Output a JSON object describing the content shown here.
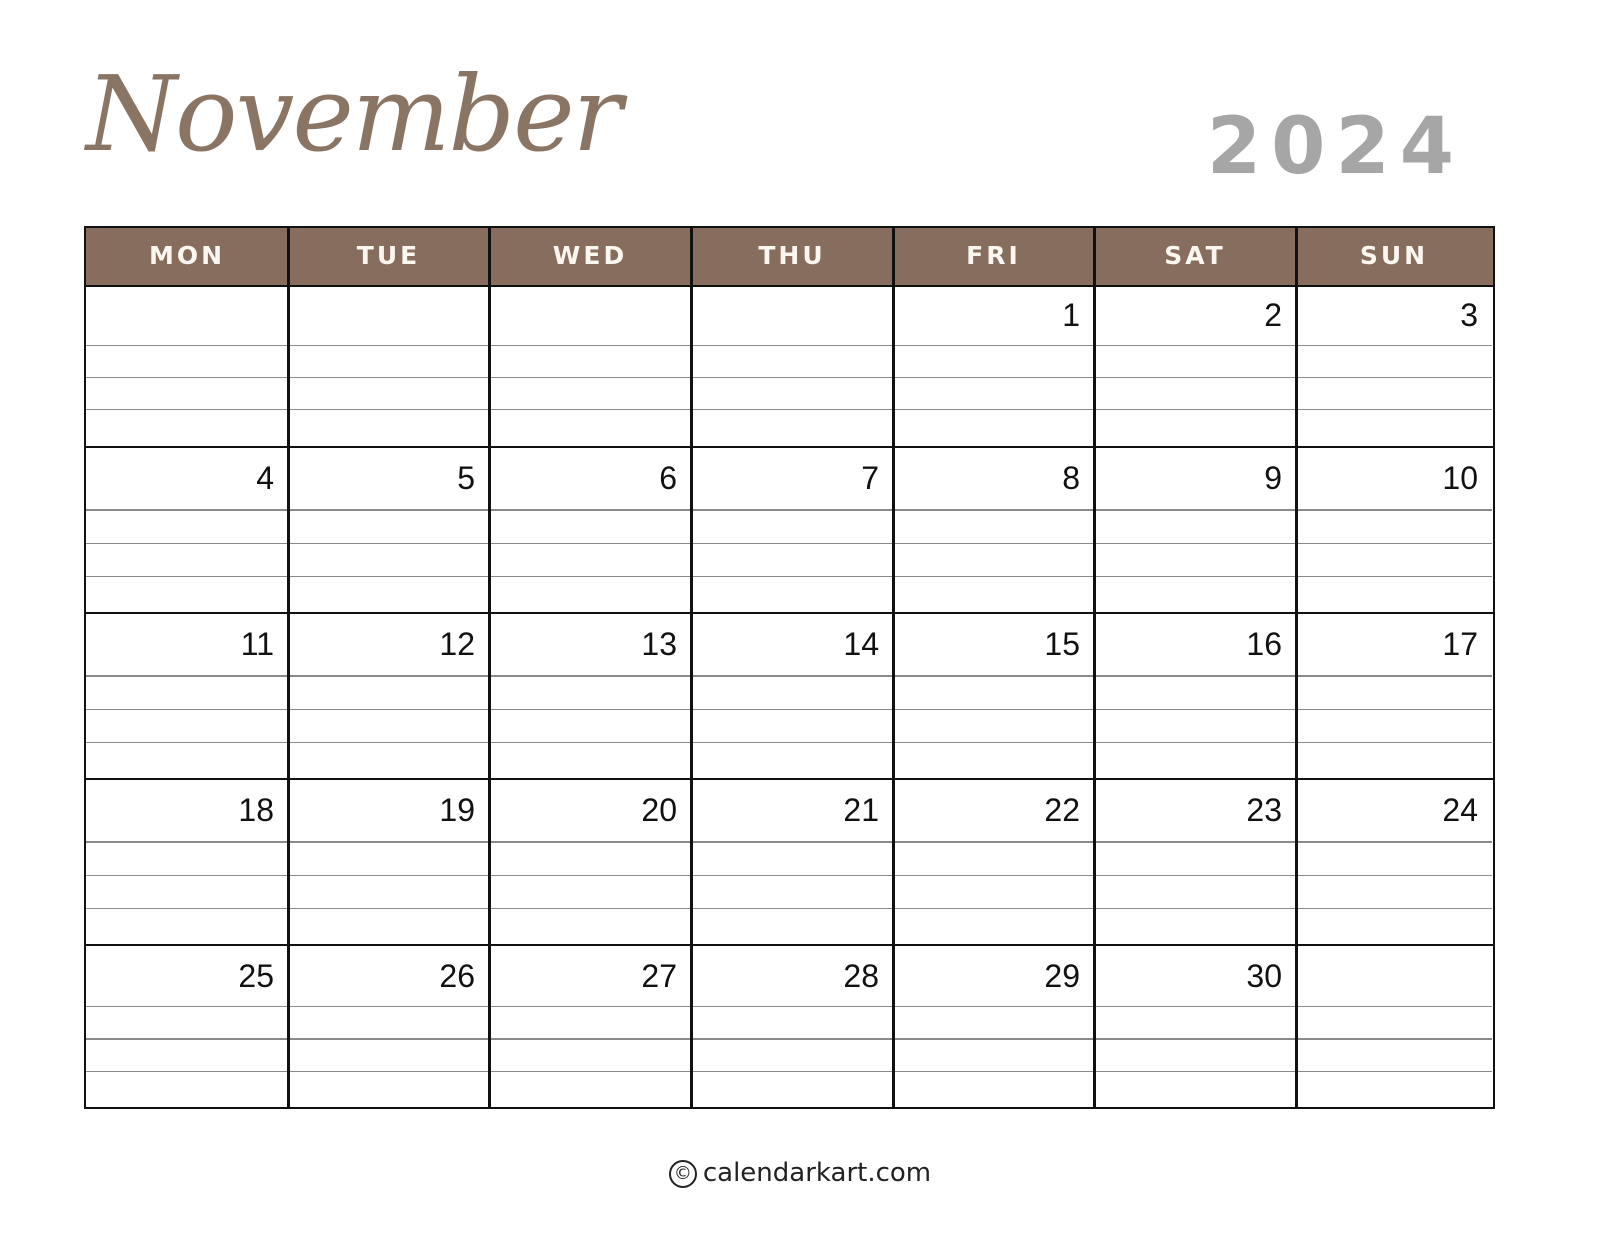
{
  "calendar": {
    "month": "November",
    "year": "2024",
    "weekdays": [
      "MON",
      "TUE",
      "WED",
      "THU",
      "FRI",
      "SAT",
      "SUN"
    ],
    "weeks": [
      [
        "",
        "",
        "",
        "",
        "1",
        "2",
        "3"
      ],
      [
        "4",
        "5",
        "6",
        "7",
        "8",
        "9",
        "10"
      ],
      [
        "11",
        "12",
        "13",
        "14",
        "15",
        "16",
        "17"
      ],
      [
        "18",
        "19",
        "20",
        "21",
        "22",
        "23",
        "24"
      ],
      [
        "25",
        "26",
        "27",
        "28",
        "29",
        "30",
        ""
      ]
    ],
    "writing_lines_per_day": 3
  },
  "footer": {
    "copyright_icon": "copyright-icon",
    "copyright_symbol": "©",
    "site": "calendarkart.com"
  },
  "colors": {
    "header_bg": "#876d5d",
    "month_text": "#8a7565",
    "year_text": "#a6a6a6",
    "header_text": "#fbf7f0"
  }
}
